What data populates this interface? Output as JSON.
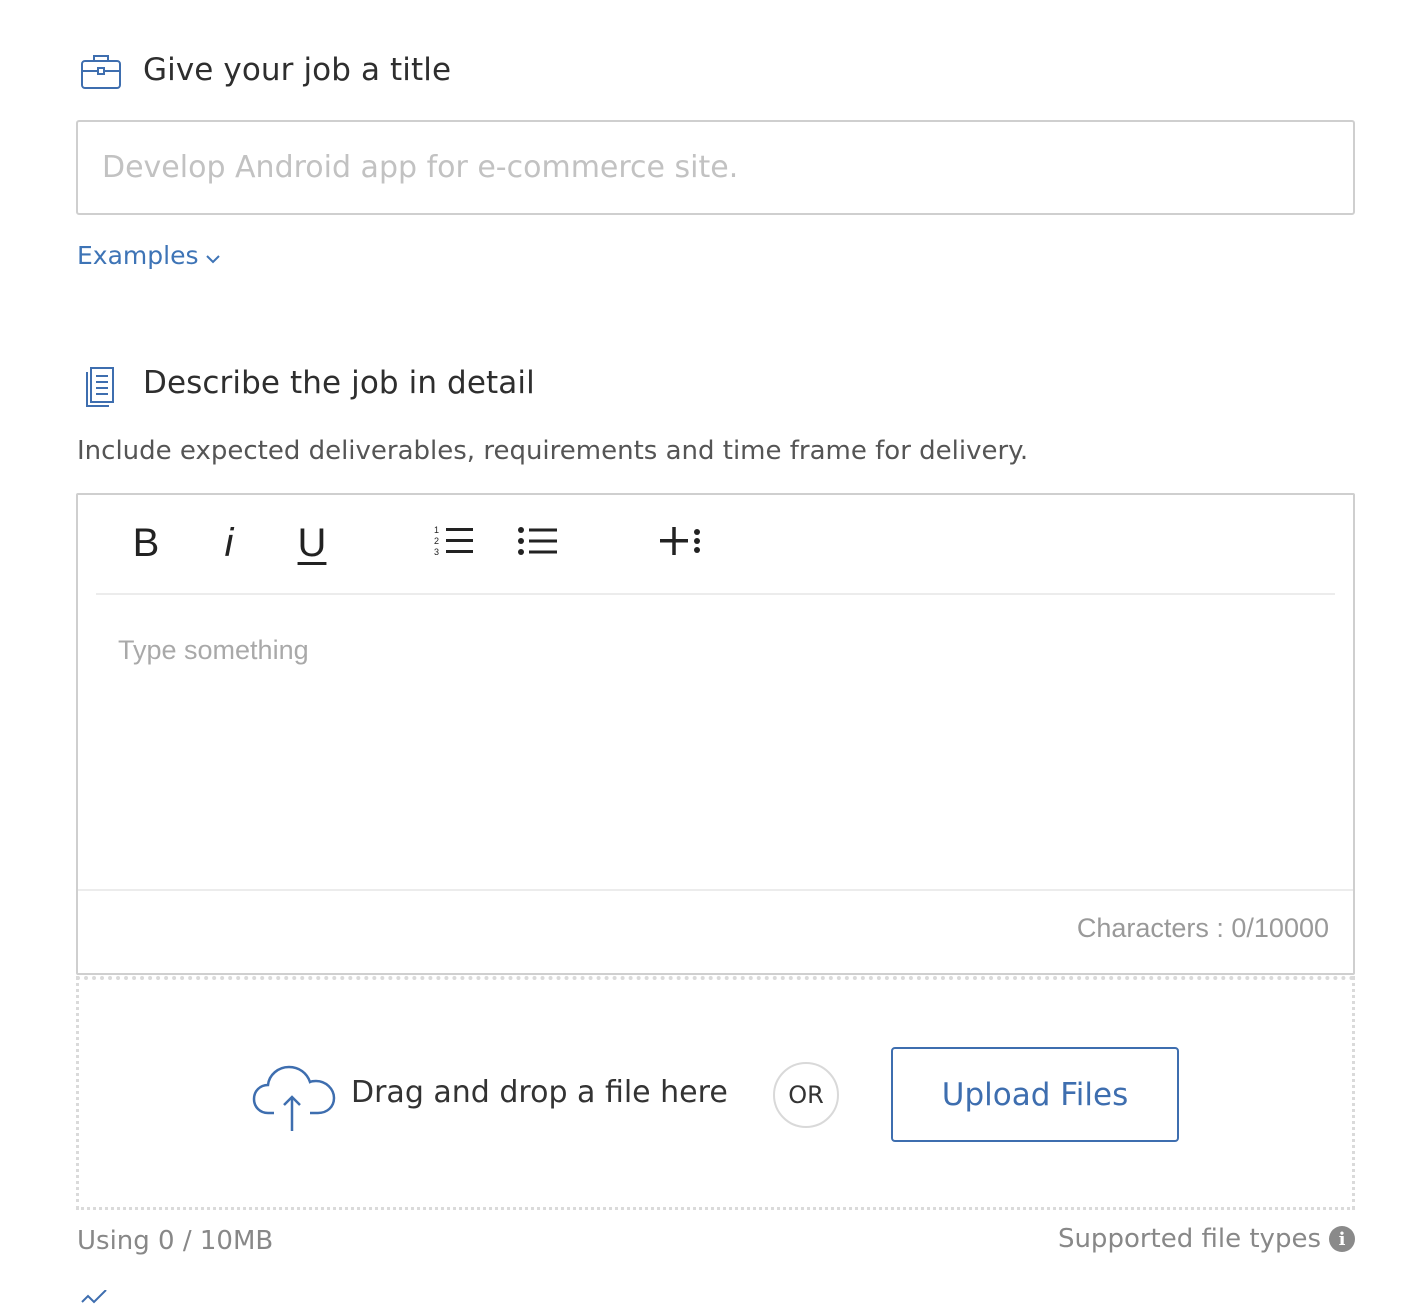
{
  "title_section": {
    "heading": "Give your job a title",
    "icon": "briefcase-icon",
    "input_placeholder": "Develop Android app for e-commerce site.",
    "input_value": "",
    "examples_label": "Examples"
  },
  "description_section": {
    "heading": "Describe the job in detail",
    "icon": "document-icon",
    "help_text": "Include expected deliverables, requirements and time frame for delivery.",
    "editor": {
      "toolbar": {
        "bold_label": "B",
        "italic_label": "i",
        "underline_label": "U",
        "ordered_list_icon": "ordered-list-icon",
        "unordered_list_icon": "unordered-list-icon",
        "insert_icon": "insert-more-icon"
      },
      "placeholder": "Type something",
      "char_count": "Characters : 0/10000"
    }
  },
  "upload": {
    "icon": "cloud-upload-icon",
    "drop_text": "Drag and drop a file here",
    "or_label": "OR",
    "button_label": "Upload Files",
    "usage": "Using 0 / 10MB",
    "supported_label": "Supported file types",
    "info_glyph": "i"
  },
  "colors": {
    "accent": "#3e74b6",
    "border": "#cfcfcf",
    "muted_text": "#888888"
  }
}
